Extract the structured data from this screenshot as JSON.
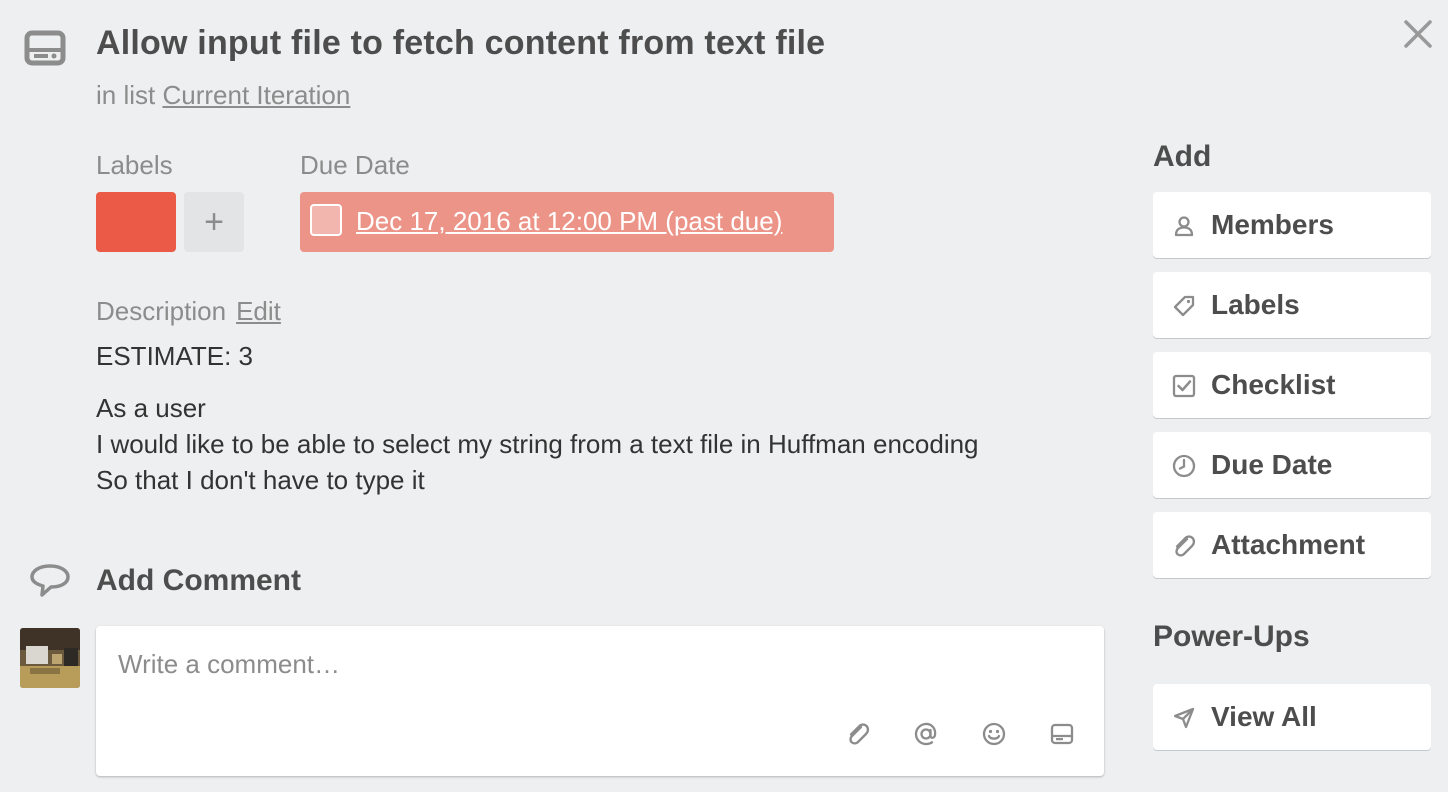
{
  "card": {
    "title": "Allow input file to fetch content from text file",
    "in_list_prefix": "in list",
    "list_name": "Current Iteration"
  },
  "labels": {
    "heading": "Labels",
    "items": [
      {
        "color": "#eb5a46"
      }
    ],
    "add_symbol": "+"
  },
  "due_date": {
    "heading": "Due Date",
    "value": "Dec 17, 2016 at 12:00 PM (past due)",
    "status_color": "#ec9488"
  },
  "description": {
    "heading": "Description",
    "edit_label": "Edit",
    "lines": [
      "ESTIMATE: 3",
      "As a user",
      "I would like to be able to select my string from a text file in Huffman encoding",
      "So that I don't have to type it"
    ]
  },
  "comment": {
    "heading": "Add Comment",
    "placeholder": "Write a comment…",
    "value": "",
    "tools": [
      "paperclip-icon",
      "at-sign-icon",
      "emoji-icon",
      "card-icon"
    ]
  },
  "sidebar": {
    "add_heading": "Add",
    "add_items": [
      {
        "label": "Members",
        "icon": "member-icon"
      },
      {
        "label": "Labels",
        "icon": "label-tag-icon"
      },
      {
        "label": "Checklist",
        "icon": "checklist-icon"
      },
      {
        "label": "Due Date",
        "icon": "clock-icon"
      },
      {
        "label": "Attachment",
        "icon": "paperclip-icon"
      }
    ],
    "powerups_heading": "Power-Ups",
    "powerups_items": [
      {
        "label": "View All",
        "icon": "rocket-icon"
      }
    ]
  },
  "colors": {
    "background": "#edeff0",
    "label_red": "#eb5a46",
    "past_due": "#ec9488",
    "muted_text": "#8c8c8c"
  }
}
